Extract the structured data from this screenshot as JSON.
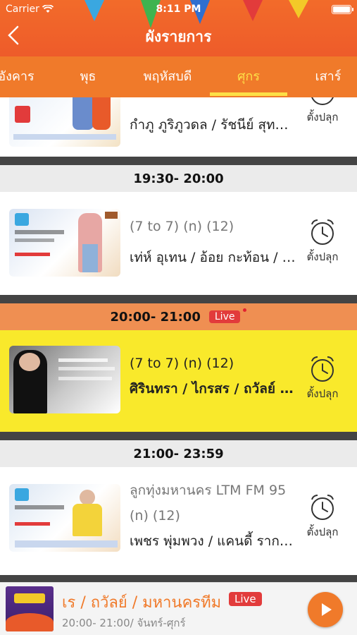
{
  "status_bar": {
    "carrier": "Carrier",
    "time": "8:11 PM"
  },
  "header": {
    "title": "ผังรายการ"
  },
  "tabs": [
    {
      "label": "อังคาร"
    },
    {
      "label": "พุธ"
    },
    {
      "label": "พฤหัสบดี"
    },
    {
      "label": "ศุกร",
      "active": true
    },
    {
      "label": "เสาร์"
    }
  ],
  "schedule": [
    {
      "time": "",
      "title": "",
      "hosts": "กำภู ภูริภูวดล / รัชนีย์ สุทธิธ...",
      "alarm_label": "ตั้งปลุก",
      "live": false
    },
    {
      "time": "19:30- 20:00",
      "title": "(7 to 7)  (n) (12)",
      "hosts": "เท่ห์ อุเทน / อ้อย กะท้อน / โอ๋...",
      "alarm_label": "ตั้งปลุก",
      "live": false
    },
    {
      "time": "20:00- 21:00",
      "live_label": "Live",
      "title": "(7 to 7)  (n) (12)",
      "hosts": "ศิรินทรา / ไกรสร / ถวัลย์ /...",
      "alarm_label": "ตั้งปลุก",
      "live": true
    },
    {
      "time": "21:00- 23:59",
      "title": "ลูกทุ่งมหานคร LTM FM 95",
      "title2": "(n) (12)",
      "hosts": "เพชร พุ่มพวง / แคนดี้ รากแ...",
      "alarm_label": "ตั้งปลุก",
      "live": false
    }
  ],
  "player": {
    "title": "เร / ถวัลย์ / มหานครทีม",
    "live_label": "Live",
    "subtitle": "20:00- 21:00/ จันทร์-ศุกร์"
  },
  "colors": {
    "accent": "#f07a2a",
    "live_highlight": "#f9e92b",
    "live_badge": "#e23b3b",
    "tab_active": "#fde047"
  }
}
